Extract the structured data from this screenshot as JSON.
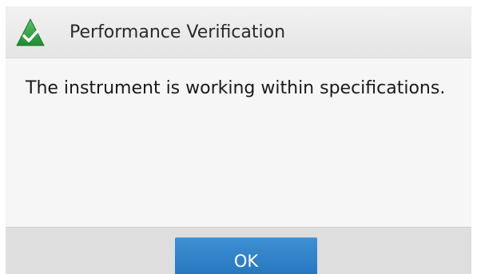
{
  "dialog": {
    "title": "Performance Verification",
    "icon": "green-checkmark-triangle-icon",
    "message": "The instrument is working within specifications.",
    "ok_label": "OK"
  },
  "colors": {
    "icon_green": "#2e9b3f",
    "button_blue": "#2a7bc2",
    "title_bar": "#ececec",
    "footer": "#dedede"
  }
}
